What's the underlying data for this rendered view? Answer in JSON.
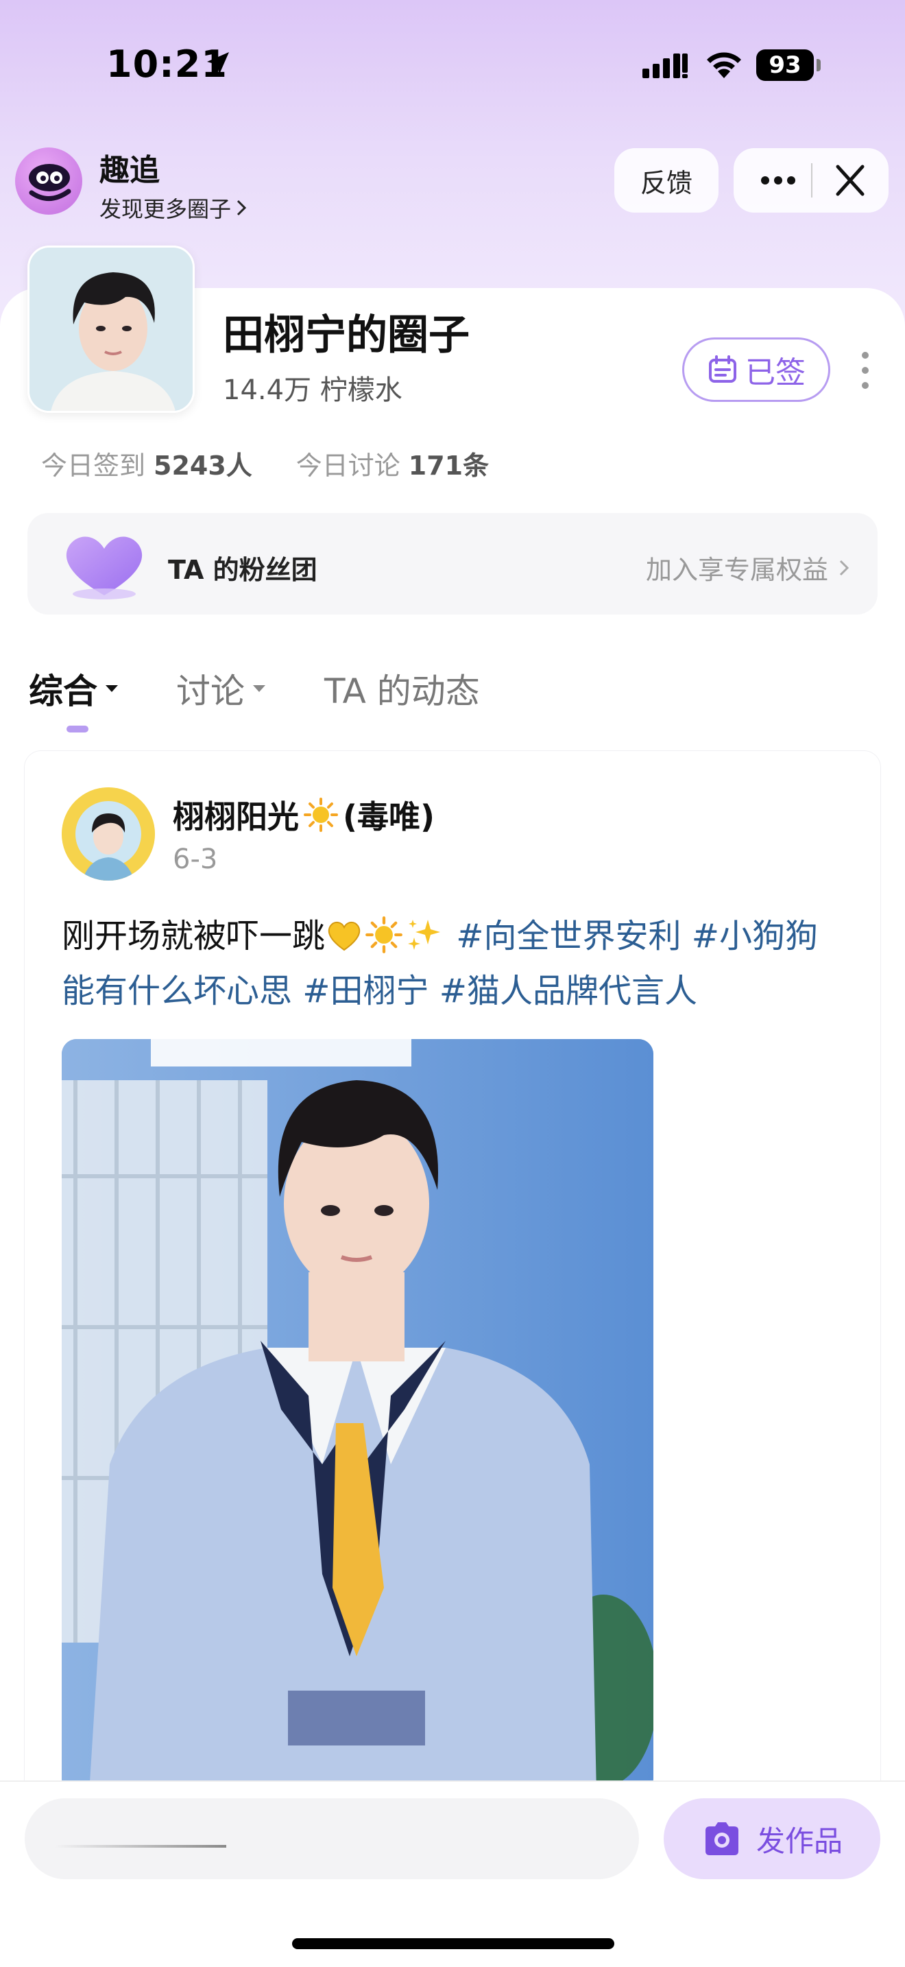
{
  "status_bar": {
    "time": "10:21",
    "battery": "93"
  },
  "app": {
    "name": "趣追",
    "discover": "发现更多圈子",
    "feedback": "反馈",
    "more_icon": "more-dots-icon",
    "close_icon": "close-icon"
  },
  "circle": {
    "title": "田栩宁的圈子",
    "followers": "14.4万 柠檬水",
    "signed_label": "已签",
    "checkin_label": "今日签到",
    "checkin_value": "5243人",
    "discuss_label": "今日讨论",
    "discuss_value": "171条"
  },
  "fan_club": {
    "label": "TA 的粉丝团",
    "join": "加入享专属权益"
  },
  "tabs": [
    {
      "label": "综合",
      "active": true
    },
    {
      "label": "讨论",
      "active": false
    },
    {
      "label": "TA 的动态",
      "active": false
    }
  ],
  "post": {
    "author": "栩栩阳光",
    "author_suffix": "(毒唯)",
    "date": "6-3",
    "text": "刚开场就被吓一跳",
    "tags": [
      "#向全世界安利",
      "#小狗狗能有什么坏心思",
      "#田栩宁",
      "#猫人品牌代言人"
    ]
  },
  "bottom": {
    "publish": "发作品"
  },
  "colors": {
    "accent": "#8d63e8",
    "tag": "#2c5e93",
    "header_bg": "#dcc6f7"
  }
}
